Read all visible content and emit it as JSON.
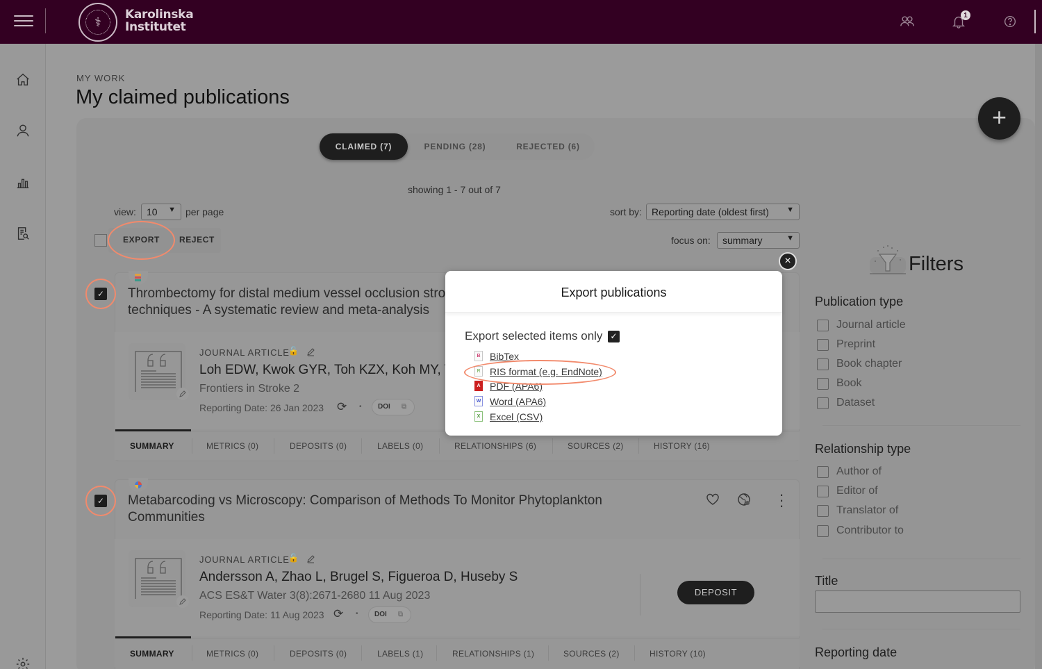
{
  "header": {
    "brand_line1": "Karolinska",
    "brand_line2": "Institutet",
    "notification_count": "1",
    "icons": [
      "menu-icon",
      "people-icon",
      "bell-icon",
      "help-icon"
    ]
  },
  "left_rail": {
    "icons": [
      "home-icon",
      "profile-icon",
      "stats-icon",
      "search-document-icon",
      "settings-icon"
    ]
  },
  "page": {
    "eyebrow": "MY WORK",
    "title": "My claimed publications"
  },
  "tabs": [
    {
      "label": "CLAIMED (7)",
      "active": true
    },
    {
      "label": "PENDING (28)",
      "active": false
    },
    {
      "label": "REJECTED (6)",
      "active": false
    }
  ],
  "listing": {
    "showing": "showing 1 - 7 out of 7",
    "view_label": "view:",
    "view_value": "10",
    "per_page_label": "per page",
    "sort_label": "sort by:",
    "sort_value": "Reporting date (oldest first)",
    "focus_label": "focus on:",
    "focus_value": "summary",
    "export_label": "EXPORT",
    "reject_label": "REJECT"
  },
  "publications": [
    {
      "checked": true,
      "title_line1": "Thrombectomy for distal medium vessel occlusion stro",
      "title_line2": "techniques - A systematic review and meta-analysis",
      "type": "JOURNAL ARTICLE",
      "authors": "Loh EDW, Kwok GYR, Toh KZX, Koh MY, Teo",
      "journal": "Frontiers in Stroke 2",
      "reporting_date": "Reporting Date: 26 Jan 2023",
      "doi_label": "DOI",
      "tabs": [
        "SUMMARY",
        "METRICS (0)",
        "DEPOSITS (0)",
        "LABELS (0)",
        "RELATIONSHIPS (6)",
        "SOURCES (2)",
        "HISTORY (16)"
      ]
    },
    {
      "checked": true,
      "title_line1": "Metabarcoding vs Microscopy: Comparison of Methods To Monitor Phytoplankton",
      "title_line2": "Communities",
      "type": "JOURNAL ARTICLE",
      "authors": "Andersson A, Zhao L, Brugel S, Figueroa D, Huseby S",
      "journal": "ACS ES&T Water 3(8):2671-2680 11 Aug 2023",
      "reporting_date": "Reporting Date: 11 Aug 2023",
      "doi_label": "DOI",
      "deposit_label": "DEPOSIT",
      "tabs": [
        "SUMMARY",
        "METRICS (0)",
        "DEPOSITS (0)",
        "LABELS (1)",
        "RELATIONSHIPS (1)",
        "SOURCES (2)",
        "HISTORY (10)"
      ]
    }
  ],
  "filters": {
    "title": "Filters",
    "publication_type": {
      "heading": "Publication type",
      "options": [
        "Journal article",
        "Preprint",
        "Book chapter",
        "Book",
        "Dataset"
      ]
    },
    "relationship_type": {
      "heading": "Relationship type",
      "options": [
        "Author of",
        "Editor of",
        "Translator of",
        "Contributor to"
      ]
    },
    "title_filter": {
      "heading": "Title",
      "value": ""
    },
    "reporting_date": {
      "heading": "Reporting date"
    }
  },
  "export_modal": {
    "title": "Export publications",
    "selected_only_label": "Export selected items only",
    "selected_only_checked": true,
    "formats": [
      {
        "label": "BibTex",
        "icon": "bibtex-file-icon",
        "icon_letter": "B",
        "color": "#d04a7a"
      },
      {
        "label": "RIS format (e.g. EndNote)",
        "icon": "ris-file-icon",
        "icon_letter": "R",
        "color": "#8fbf7a"
      },
      {
        "label": "PDF (APA6)",
        "icon": "pdf-file-icon",
        "icon_letter": "A",
        "color": "#cc1f1f"
      },
      {
        "label": "Word (APA6)",
        "icon": "word-file-icon",
        "icon_letter": "W",
        "color": "#4a5bd0"
      },
      {
        "label": "Excel (CSV)",
        "icon": "excel-file-icon",
        "icon_letter": "X",
        "color": "#4e9a3a"
      }
    ]
  },
  "colors": {
    "brand": "#330022",
    "highlight_ring": "#f28a6c",
    "dark_button": "#1e1e1e"
  }
}
